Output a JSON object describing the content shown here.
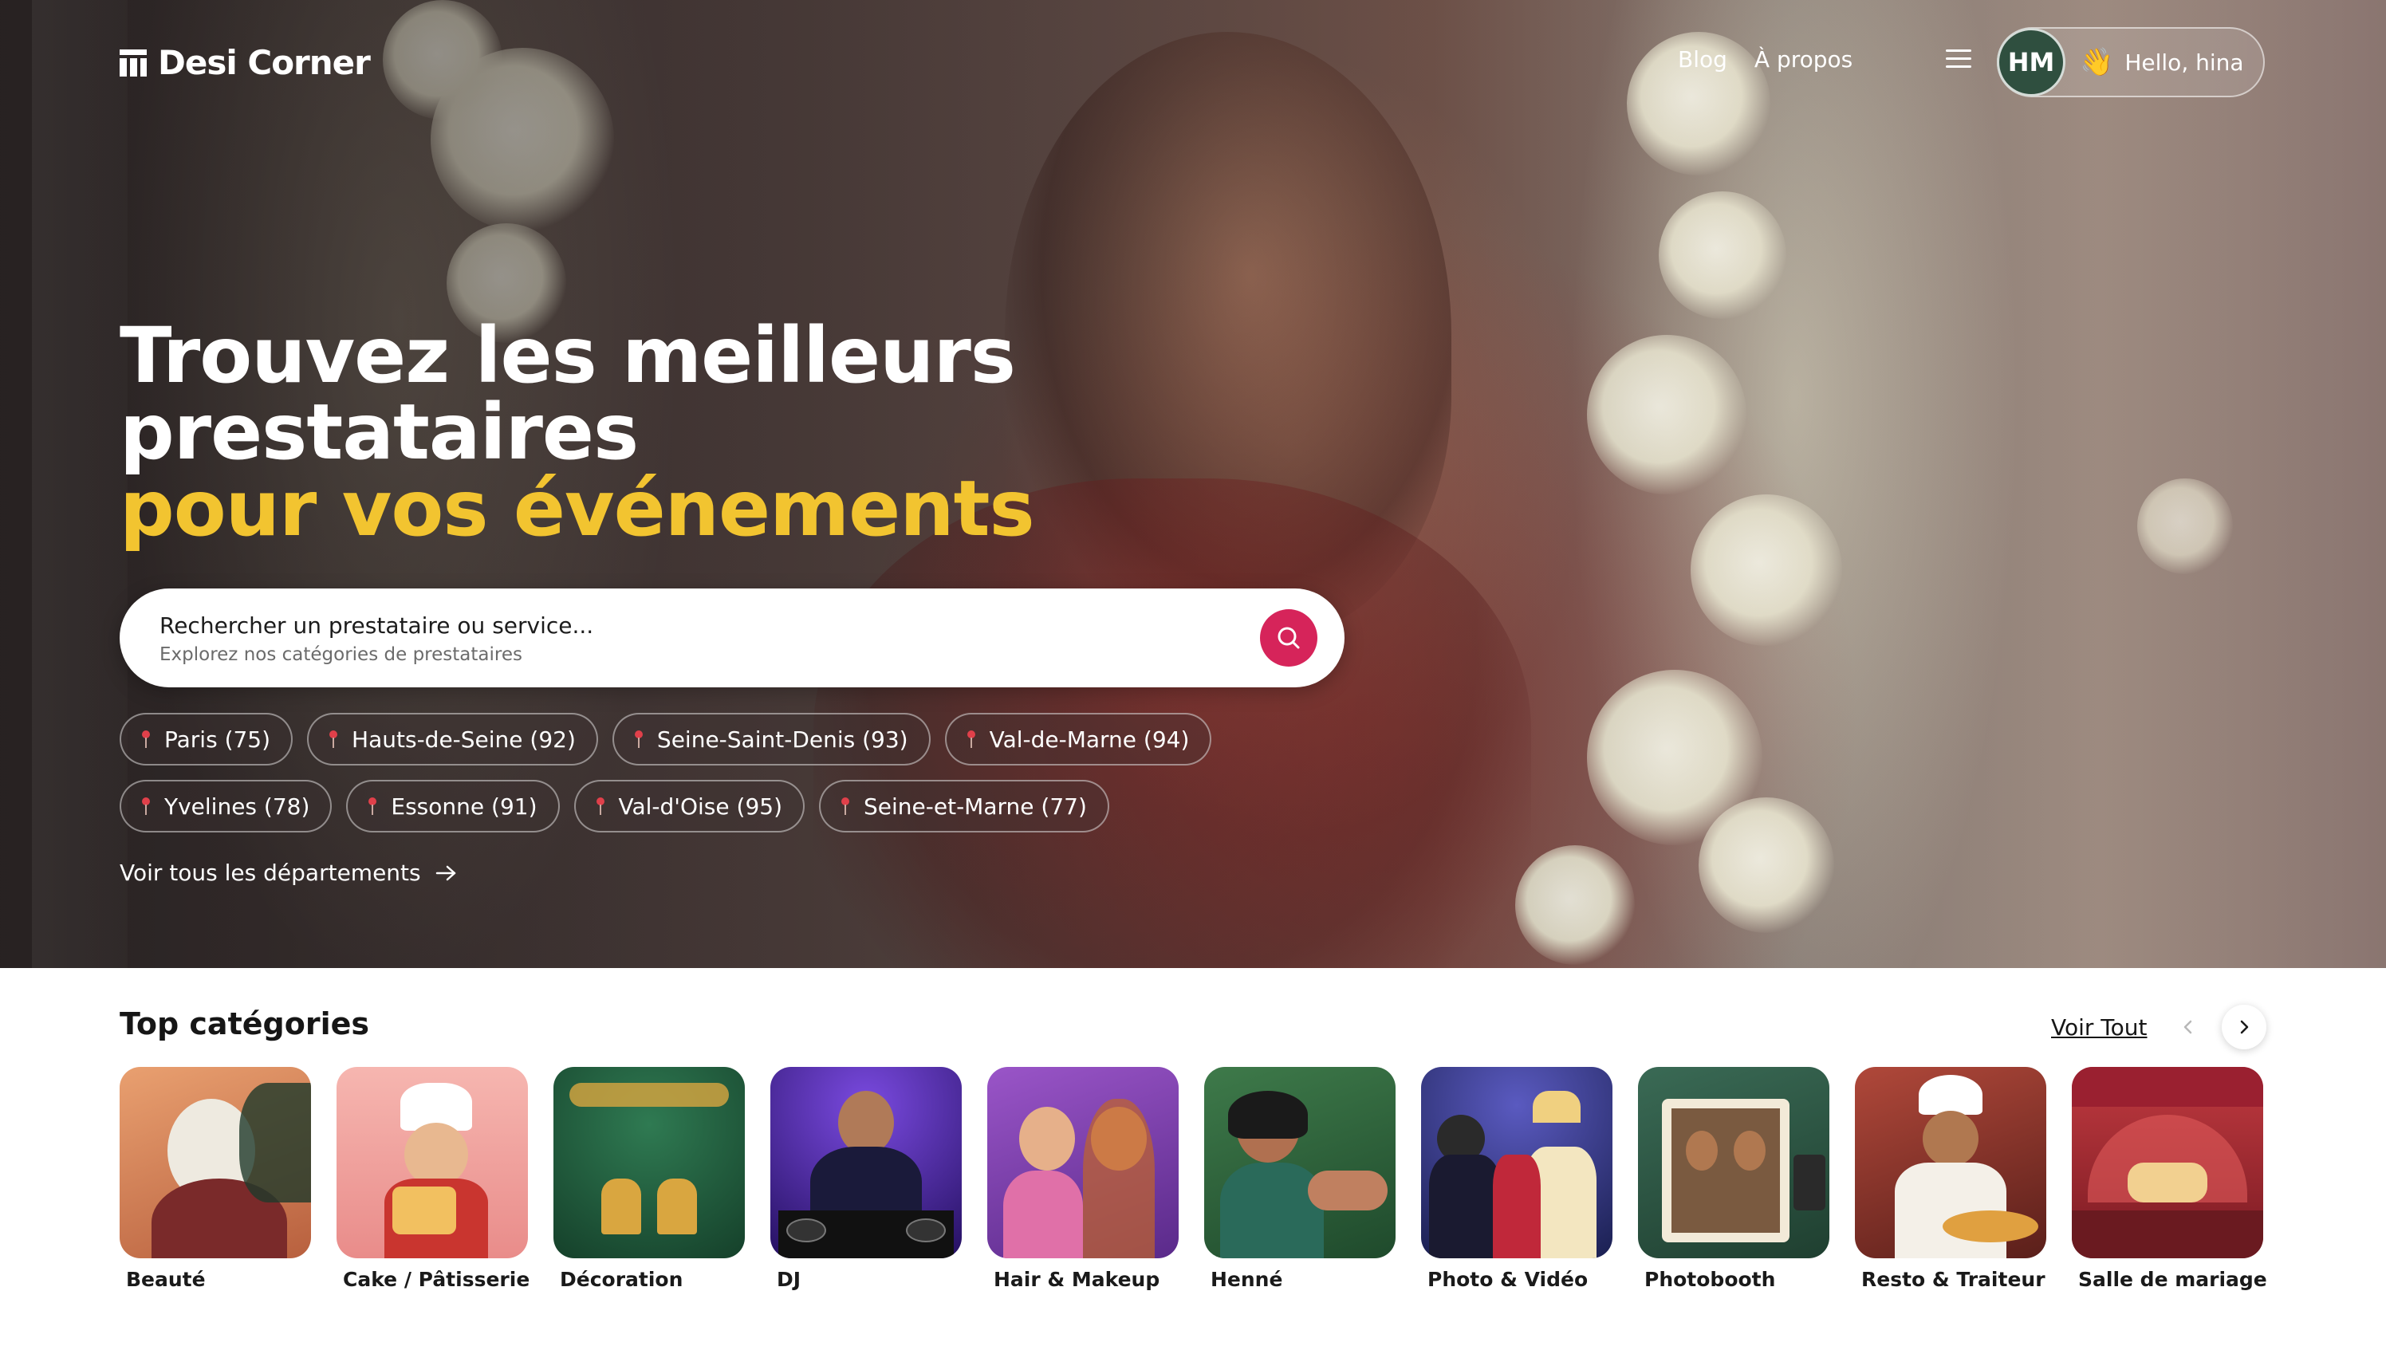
{
  "brand": {
    "name": "Desi Corner"
  },
  "nav": {
    "items": [
      "Blog",
      "À propos"
    ]
  },
  "user": {
    "initials": "HM",
    "wave": "👋",
    "greeting": "Hello, hina"
  },
  "hero": {
    "line1": "Trouvez les meilleurs",
    "line2": "prestataires",
    "line3": "pour vos événements"
  },
  "search": {
    "title": "Rechercher un prestataire ou service...",
    "subtitle": "Explorez nos catégories de prestataires"
  },
  "departments": {
    "row1": [
      "Paris (75)",
      "Hauts-de-Seine (92)",
      "Seine-Saint-Denis (93)",
      "Val-de-Marne (94)"
    ],
    "row2": [
      "Yvelines (78)",
      "Essonne (91)",
      "Val-d'Oise (95)",
      "Seine-et-Marne (77)"
    ],
    "see_all": "Voir tous les départements"
  },
  "categories": {
    "title": "Top catégories",
    "see_all": "Voir Tout",
    "items": [
      {
        "label": "Beauté",
        "bg": "#c97c56"
      },
      {
        "label": "Cake / Pâtisserie",
        "bg": "#f2a8a8"
      },
      {
        "label": "Décoration",
        "bg": "#1f5a3c"
      },
      {
        "label": "DJ",
        "bg": "#3b1f7a"
      },
      {
        "label": "Hair & Makeup",
        "bg": "#7a3fa0"
      },
      {
        "label": "Henné",
        "bg": "#2f5a3a"
      },
      {
        "label": "Photo & Vidéo",
        "bg": "#2a2f6a"
      },
      {
        "label": "Photobooth",
        "bg": "#2d5a45"
      },
      {
        "label": "Resto & Traiteur",
        "bg": "#8a2f2a"
      },
      {
        "label": "Salle de mariage",
        "bg": "#8a1f2a"
      }
    ]
  },
  "colors": {
    "accent_yellow": "#f2c430",
    "search_button": "#d6245a"
  }
}
